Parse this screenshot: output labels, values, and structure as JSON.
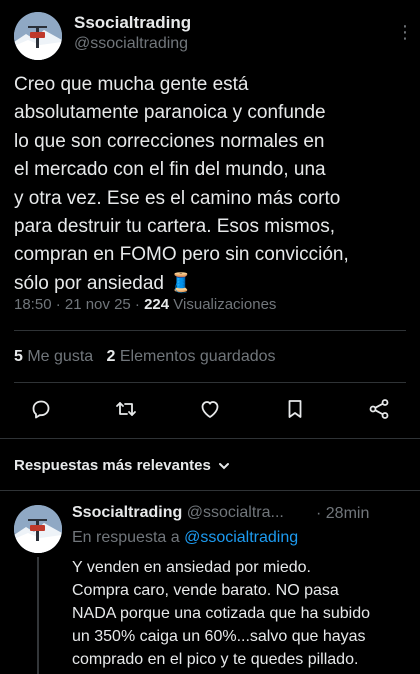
{
  "tweet": {
    "author_name": "Ssocialtrading",
    "author_handle": "@ssocialtrading",
    "more_menu": "⋮",
    "text": "Creo que mucha gente está\nabsolutamente paranoica y confunde\nlo que son correcciones normales en\nel mercado con el fin del mundo, una\ny otra vez. Ese es el camino más corto\npara destruir tu cartera. Esos mismos,\ncompran en FOMO pero sin convicción,\nsólo por ansiedad",
    "emoji": "🧵",
    "time": "18:50 · 21 nov 25 · ",
    "views_count": "224",
    "views_label": " Visualizaciones",
    "likes_count": "5",
    "likes_label": " Me gusta",
    "bookmarks_count": "2",
    "bookmarks_label": " Elementos guardados"
  },
  "actions": {
    "icons": [
      "reply-icon",
      "retweet-icon",
      "like-icon",
      "bookmark-icon",
      "share-icon"
    ]
  },
  "replies_sort": {
    "label": "Respuestas más relevantes"
  },
  "reply": {
    "author_name": "Ssocialtrading",
    "author_handle": "@ssocialtra...",
    "time": "· 28min",
    "in_reply_prefix": "En respuesta a ",
    "in_reply_handle": "@ssocialtrading",
    "text": "Y venden en ansiedad por miedo.\nCompra caro, vende barato. NO pasa\nNADA porque una cotizada que ha subido\nun 350% caiga un 60%...salvo que hayas\ncomprado en el pico y te quedes pillado."
  },
  "colors": {
    "background": "#000000",
    "text": "#e7e9ea",
    "secondary": "#71767b",
    "link": "#1d9bf0",
    "divider": "#2f3336"
  }
}
